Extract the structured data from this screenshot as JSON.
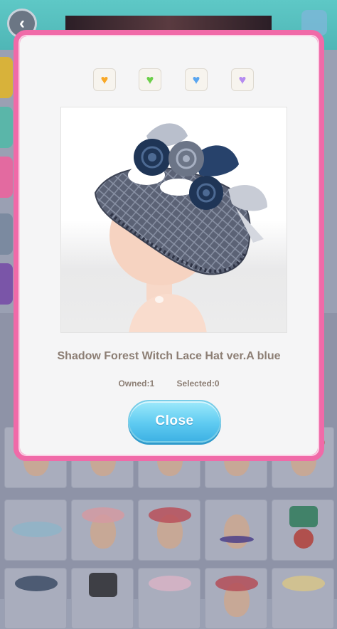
{
  "background": {
    "back_glyph": "‹"
  },
  "modal": {
    "color_variants": [
      {
        "name": "orange",
        "color": "#f9a825",
        "glyph": "♥"
      },
      {
        "name": "green",
        "color": "#6ccf4a",
        "glyph": "♥"
      },
      {
        "name": "blue",
        "color": "#5aa6f0",
        "glyph": "♥"
      },
      {
        "name": "purple",
        "color": "#b58bf0",
        "glyph": "♥"
      }
    ],
    "item_name": "Shadow Forest Witch Lace Hat ver.A blue",
    "owned_label": "Owned:1",
    "selected_label": "Selected:0",
    "close_label": "Close"
  },
  "colors": {
    "frame": "#f06aa8",
    "button": "#5fcbf1",
    "text": "#8c7e74"
  }
}
